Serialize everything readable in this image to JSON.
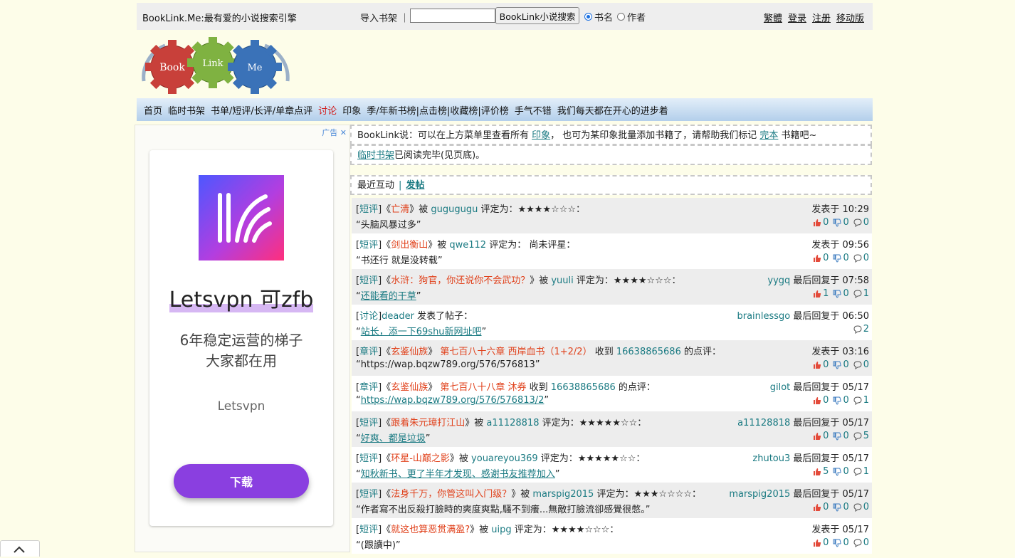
{
  "header": {
    "site_title": "BookLink.Me:最有爱的小说搜索引擎",
    "import_label": "导入书架 ｜",
    "search_value": "",
    "search_button": "BookLink小说搜索",
    "radio_book": "书名",
    "radio_author": "作者",
    "links": [
      "繁體",
      "登录",
      "注册",
      "移动版"
    ]
  },
  "logo": {
    "gear1": "Book",
    "gear2": "Link",
    "gear3": "Me"
  },
  "nav": {
    "items": [
      "首页",
      "临时书架",
      "书单/短评/长评/单章点评",
      "讨论",
      "印象",
      "季/年新书榜|点击榜|收藏榜|评价榜",
      "手气不错",
      "我们每天都在开心的进步着"
    ],
    "hot_index": 3
  },
  "ad": {
    "tag": "广告",
    "close": "✕",
    "title": "Letsvpn 可zfb",
    "sub1": "6年稳定运营的梯子",
    "sub2": "大家都在用",
    "brand": "Letsvpn",
    "button": "下载"
  },
  "notice": {
    "pre": "BookLink说：可以在上方菜单里查看所有 ",
    "link1": "印象",
    "mid": "， 也可为某印象批量添加书籍了，请帮助我们标记 ",
    "link2": "完本",
    "post": " 书籍吧~",
    "shelf_link": "临时书架",
    "shelf_text": "已阅读完毕(见页底)。"
  },
  "section": {
    "title": "最近互动",
    "sep": "|",
    "post": "发帖"
  },
  "feed": [
    {
      "type": "短评",
      "book": "亡清",
      "sep": "》被",
      "user": "gugugugu",
      "action": "评定为：★★★★☆☆☆：",
      "quote": "头脑风暴过多",
      "linked": false,
      "right_user": "",
      "right_text": "发表于 10:29",
      "up": "0",
      "down": "0",
      "comments": "0"
    },
    {
      "type": "短评",
      "book": "剑出衡山",
      "sep": "》被",
      "user": "qwe112",
      "action": "评定为：  尚未评星：",
      "quote": "书还行 就是没转载",
      "linked": false,
      "right_user": "",
      "right_text": "发表于 09:56",
      "up": "0",
      "down": "0",
      "comments": "0"
    },
    {
      "type": "短评",
      "book": "水浒：狗官，你还说你不会武功？",
      "sep": "》被",
      "user": "yuuli",
      "action": "评定为：★★★★☆☆☆：",
      "quote": "还能看的干草",
      "linked": true,
      "right_user": "yygq",
      "right_text": " 最后回复于 07:58",
      "up": "1",
      "down": "0",
      "comments": "1"
    },
    {
      "type": "讨论",
      "book": "",
      "sep": "",
      "user": "deader",
      "action": "发表了帖子：",
      "quote": "站长，添一下69shu新网址吧",
      "linked": true,
      "right_user": "brainlessgo",
      "right_text": " 最后回复于 06:50",
      "up": "",
      "down": "",
      "comments": "2"
    },
    {
      "type": "章评",
      "book": "玄鉴仙族",
      "sep": "》",
      "chapter": "第七百八十六章 西岸血书（1+2/2）",
      "user": "16638865686",
      "action": "的点评：",
      "quote": "https://wap.bqzw789.org/576/576813",
      "linked": false,
      "right_user": "",
      "right_text": "发表于 03:16",
      "up": "0",
      "down": "0",
      "comments": "0"
    },
    {
      "type": "章评",
      "book": "玄鉴仙族",
      "sep": "》",
      "chapter": "第七百八十八章 沐券",
      "user": "16638865686",
      "action": "的点评：",
      "quote": "https://wap.bqzw789.org/576/576813/2",
      "linked": true,
      "right_user": "gilot",
      "right_text": " 最后回复于 05/17",
      "up": "0",
      "down": "0",
      "comments": "1"
    },
    {
      "type": "短评",
      "book": "跟着朱元璋打江山",
      "sep": "》被",
      "user": "a11128818",
      "action": "评定为：★★★★★☆☆：",
      "quote": "好爽、都是垃圾",
      "linked": true,
      "right_user": "a11128818",
      "right_text": " 最后回复于 05/17",
      "up": "0",
      "down": "0",
      "comments": "5"
    },
    {
      "type": "短评",
      "book": "环星-山巅之影",
      "sep": "》被",
      "user": "youareyou369",
      "action": "评定为：★★★★★☆☆：",
      "quote": "知秋新书、更了半年才发现、感谢书友推荐加入",
      "linked": true,
      "right_user": "zhutou3",
      "right_text": " 最后回复于 05/17",
      "up": "5",
      "down": "0",
      "comments": "1"
    },
    {
      "type": "短评",
      "book": "法身千万，你管这叫入门级？",
      "sep": "》被",
      "user": "marspig2015",
      "action": "评定为：★★★☆☆☆☆：",
      "quote": "作者寫不出反殺打臉時的爽度爽點,騷不到癢...無敵打臉流卻感覺很憋。",
      "linked": false,
      "right_user": "marspig2015",
      "right_text": " 最后回复于 05/17",
      "up": "0",
      "down": "0",
      "comments": "0"
    },
    {
      "type": "短评",
      "book": "就这也算恶贯满盈?",
      "sep": "》被",
      "user": "uipg",
      "action": "评定为：★★★★☆☆☆：",
      "quote": "(跟讀中)",
      "linked": false,
      "right_user": "",
      "right_text": "发表于 05/17",
      "up": "0",
      "down": "0",
      "comments": "0"
    }
  ]
}
